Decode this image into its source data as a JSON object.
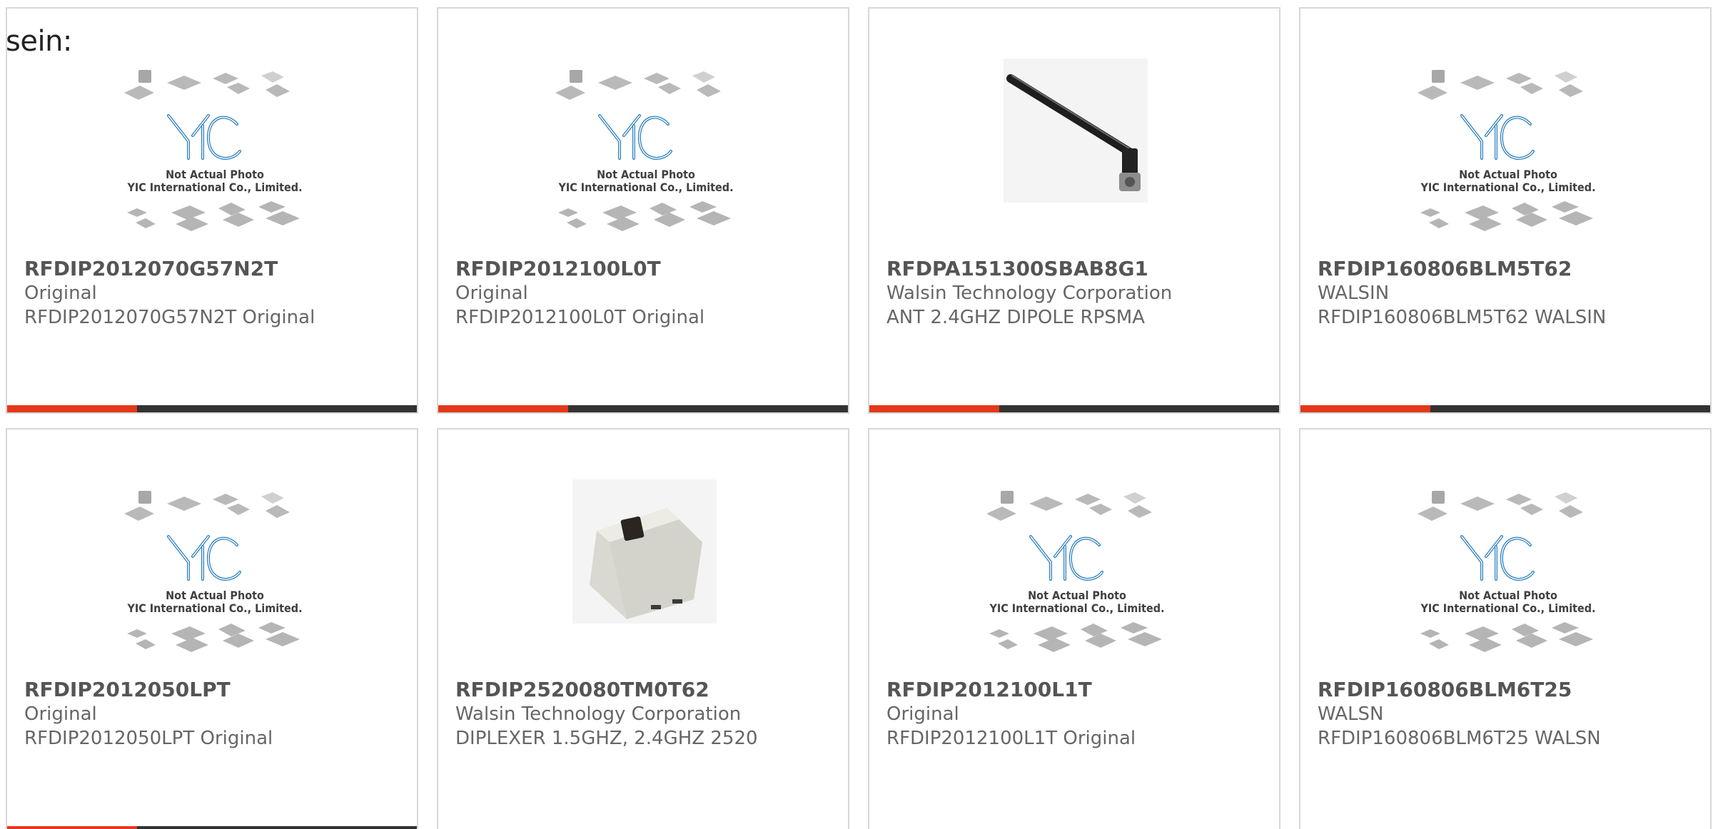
{
  "page": {
    "lead_text": "sein:"
  },
  "colors": {
    "accent": "#e3381c",
    "stripe": "#333333",
    "brand_blue": "#2b7fc0"
  },
  "placeholder": {
    "line1": "Not Actual Photo",
    "line2": "YIC International Co., Limited.",
    "brand": "YIC"
  },
  "products": [
    {
      "part_no": "RFDIP2012070G57N2T",
      "manufacturer": "Original",
      "description": "RFDIP2012070G57N2T Original",
      "image": "not-actual-photo"
    },
    {
      "part_no": "RFDIP2012100L0T",
      "manufacturer": "Original",
      "description": "RFDIP2012100L0T Original",
      "image": "not-actual-photo"
    },
    {
      "part_no": "RFDPA151300SBAB8G1",
      "manufacturer": "Walsin Technology Corporation",
      "description": "ANT 2.4GHZ DIPOLE RPSMA",
      "image": "antenna-photo"
    },
    {
      "part_no": "RFDIP160806BLM5T62",
      "manufacturer": "WALSIN",
      "description": "RFDIP160806BLM5T62 WALSIN",
      "image": "not-actual-photo"
    },
    {
      "part_no": "RFDIP2012050LPT",
      "manufacturer": "Original",
      "description": "RFDIP2012050LPT Original",
      "image": "not-actual-photo"
    },
    {
      "part_no": "RFDIP2520080TM0T62",
      "manufacturer": "Walsin Technology Corporation",
      "description": "DIPLEXER 1.5GHZ, 2.4GHZ 2520",
      "image": "chip-component-photo"
    },
    {
      "part_no": "RFDIP2012100L1T",
      "manufacturer": "Original",
      "description": "RFDIP2012100L1T Original",
      "image": "not-actual-photo"
    },
    {
      "part_no": "RFDIP160806BLM6T25",
      "manufacturer": "WALSN",
      "description": "RFDIP160806BLM6T25 WALSN",
      "image": "not-actual-photo"
    }
  ]
}
